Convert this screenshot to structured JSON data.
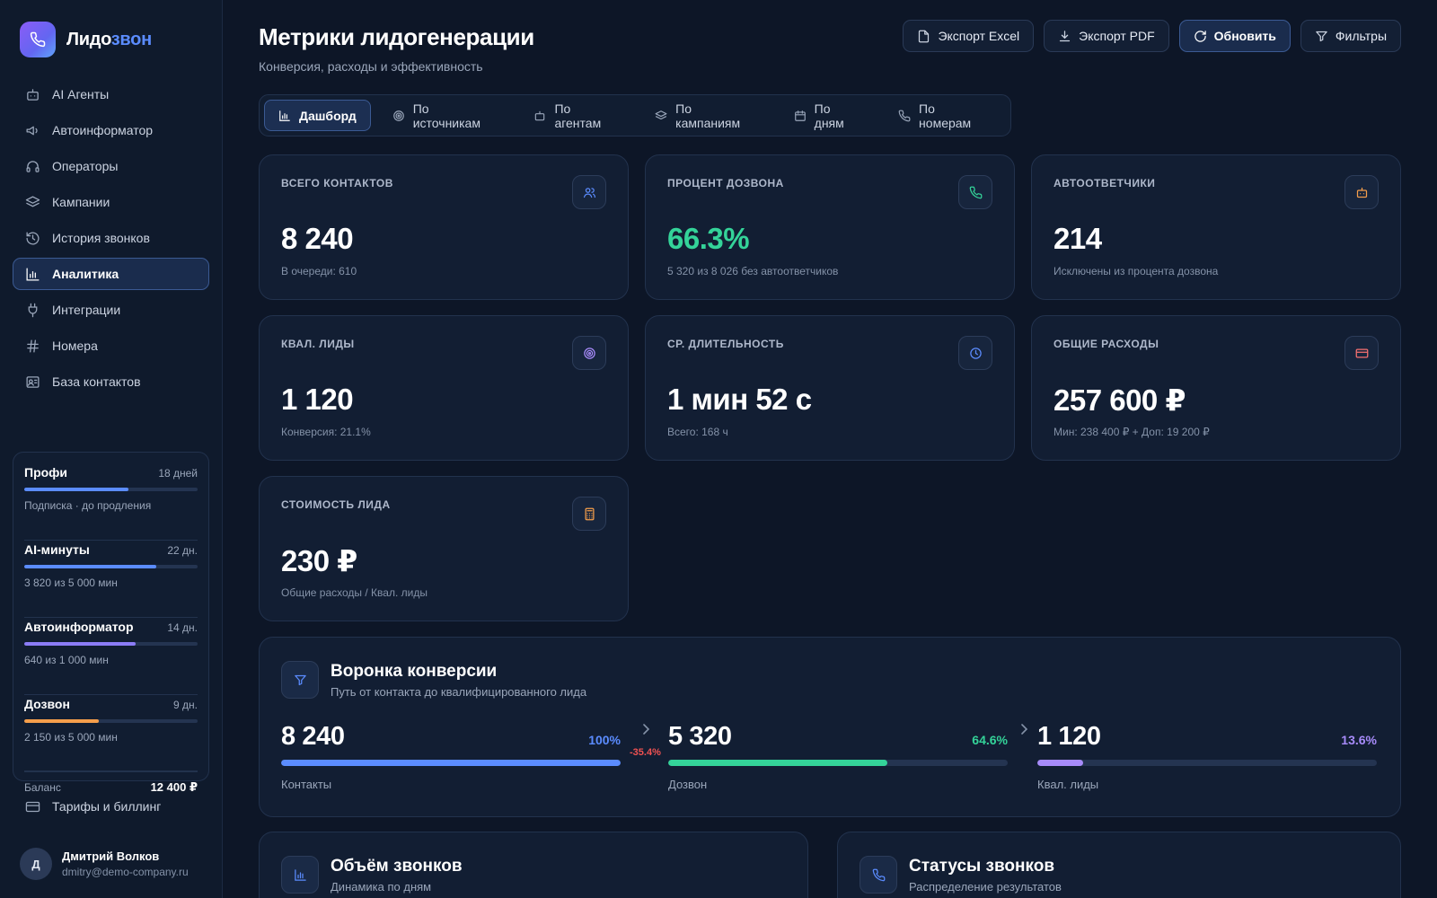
{
  "brand": {
    "name_main": "Лидо",
    "name_accent": "звон"
  },
  "nav": {
    "items": [
      {
        "label": "AI Агенты",
        "icon": "robot-icon",
        "active": false
      },
      {
        "label": "Автоинформатор",
        "icon": "megaphone-icon",
        "active": false
      },
      {
        "label": "Операторы",
        "icon": "headset-icon",
        "active": false
      },
      {
        "label": "Кампании",
        "icon": "layers-icon",
        "active": false
      },
      {
        "label": "История звонков",
        "icon": "history-icon",
        "active": false
      },
      {
        "label": "Аналитика",
        "icon": "bar-chart-icon",
        "active": true
      },
      {
        "label": "Интеграции",
        "icon": "plug-icon",
        "active": false
      },
      {
        "label": "Номера",
        "icon": "hash-icon",
        "active": false
      },
      {
        "label": "База контактов",
        "icon": "contact-card-icon",
        "active": false
      }
    ],
    "billing_label": "Тарифы и биллинг"
  },
  "subscriptions": [
    {
      "name": "Профи",
      "days": "18 дней",
      "desc": "Подписка · до продления",
      "progress": 0.6,
      "color": "#5b8cff"
    },
    {
      "name": "AI-минуты",
      "days": "22 дн.",
      "desc": "3 820 из 5 000 мин",
      "progress": 0.764,
      "color": "#5b8cff"
    },
    {
      "name": "Автоинформатор",
      "days": "14 дн.",
      "desc": "640 из 1 000 мин",
      "progress": 0.64,
      "color": "#8b7cf6"
    },
    {
      "name": "Дозвон",
      "days": "9 дн.",
      "desc": "2 150 из 5 000 мин",
      "progress": 0.43,
      "color": "#f59e4b"
    }
  ],
  "balance": {
    "label": "Баланс",
    "value": "12 400 ₽"
  },
  "user": {
    "initial": "Д",
    "name": "Дмитрий Волков",
    "email": "dmitry@demo-company.ru"
  },
  "header": {
    "title": "Метрики лидогенерации",
    "subtitle": "Конверсия, расходы и эффективность",
    "buttons": {
      "export_excel": "Экспорт Excel",
      "export_pdf": "Экспорт PDF",
      "refresh": "Обновить",
      "filters": "Фильтры"
    }
  },
  "tabs": [
    {
      "label": "Дашборд",
      "icon": "bar-chart-icon",
      "active": true
    },
    {
      "label": "По источникам",
      "icon": "target-icon",
      "active": false
    },
    {
      "label": "По агентам",
      "icon": "robot-icon",
      "active": false
    },
    {
      "label": "По кампаниям",
      "icon": "layers-icon",
      "active": false
    },
    {
      "label": "По дням",
      "icon": "calendar-icon",
      "active": false
    },
    {
      "label": "По номерам",
      "icon": "phone-icon",
      "active": false
    }
  ],
  "metrics": [
    {
      "label": "ВСЕГО КОНТАКТОВ",
      "value": "8 240",
      "note": "В очереди: 610",
      "icon": "users-icon",
      "value_color": "#ffffff",
      "icon_color": "#5b8cff"
    },
    {
      "label": "ПРОЦЕНТ ДОЗВОНА",
      "value": "66.3%",
      "note": "5 320 из 8 026 без автоответчиков",
      "icon": "phone-icon",
      "value_color": "#34d399",
      "icon_color": "#34d399"
    },
    {
      "label": "АВТООТВЕТЧИКИ",
      "value": "214",
      "note": "Исключены из процента дозвона",
      "icon": "robot-icon",
      "value_color": "#ffffff",
      "icon_color": "#f59e4b"
    },
    {
      "label": "КВАЛ. ЛИДЫ",
      "value": "1 120",
      "note": "Конверсия: 21.1%",
      "icon": "target-icon",
      "value_color": "#ffffff",
      "icon_color": "#a78bfa"
    },
    {
      "label": "СР. ДЛИТЕЛЬНОСТЬ",
      "value": "1 мин 52 с",
      "note": "Всего: 168 ч",
      "icon": "clock-icon",
      "value_color": "#ffffff",
      "icon_color": "#5b8cff"
    },
    {
      "label": "ОБЩИЕ РАСХОДЫ",
      "value": "257 600 ₽",
      "note": "Мин: 238 400 ₽ + Доп: 19 200 ₽",
      "icon": "credit-card-icon",
      "value_color": "#ffffff",
      "icon_color": "#f87171"
    },
    {
      "label": "СТОИМОСТЬ ЛИДА",
      "value": "230 ₽",
      "note": "Общие расходы / Квал. лиды",
      "icon": "calculator-icon",
      "value_color": "#ffffff",
      "icon_color": "#f59e4b"
    }
  ],
  "funnel": {
    "title": "Воронка конверсии",
    "subtitle": "Путь от контакта до квалифицированного лида",
    "stages": [
      {
        "value": "8 240",
        "pct": "100%",
        "label": "Контакты",
        "fill": 1.0,
        "color": "#5b8cff"
      },
      {
        "value": "5 320",
        "pct": "64.6%",
        "label": "Дозвон",
        "fill": 0.646,
        "color": "#34d399"
      },
      {
        "value": "1 120",
        "pct": "13.6%",
        "label": "Квал. лиды",
        "fill": 0.136,
        "color": "#a78bfa"
      }
    ],
    "drop": "-35.4%"
  },
  "panels": [
    {
      "title": "Объём звонков",
      "subtitle": "Динамика по дням",
      "icon": "bar-chart-icon"
    },
    {
      "title": "Статусы звонков",
      "subtitle": "Распределение результатов",
      "icon": "phone-icon"
    }
  ]
}
